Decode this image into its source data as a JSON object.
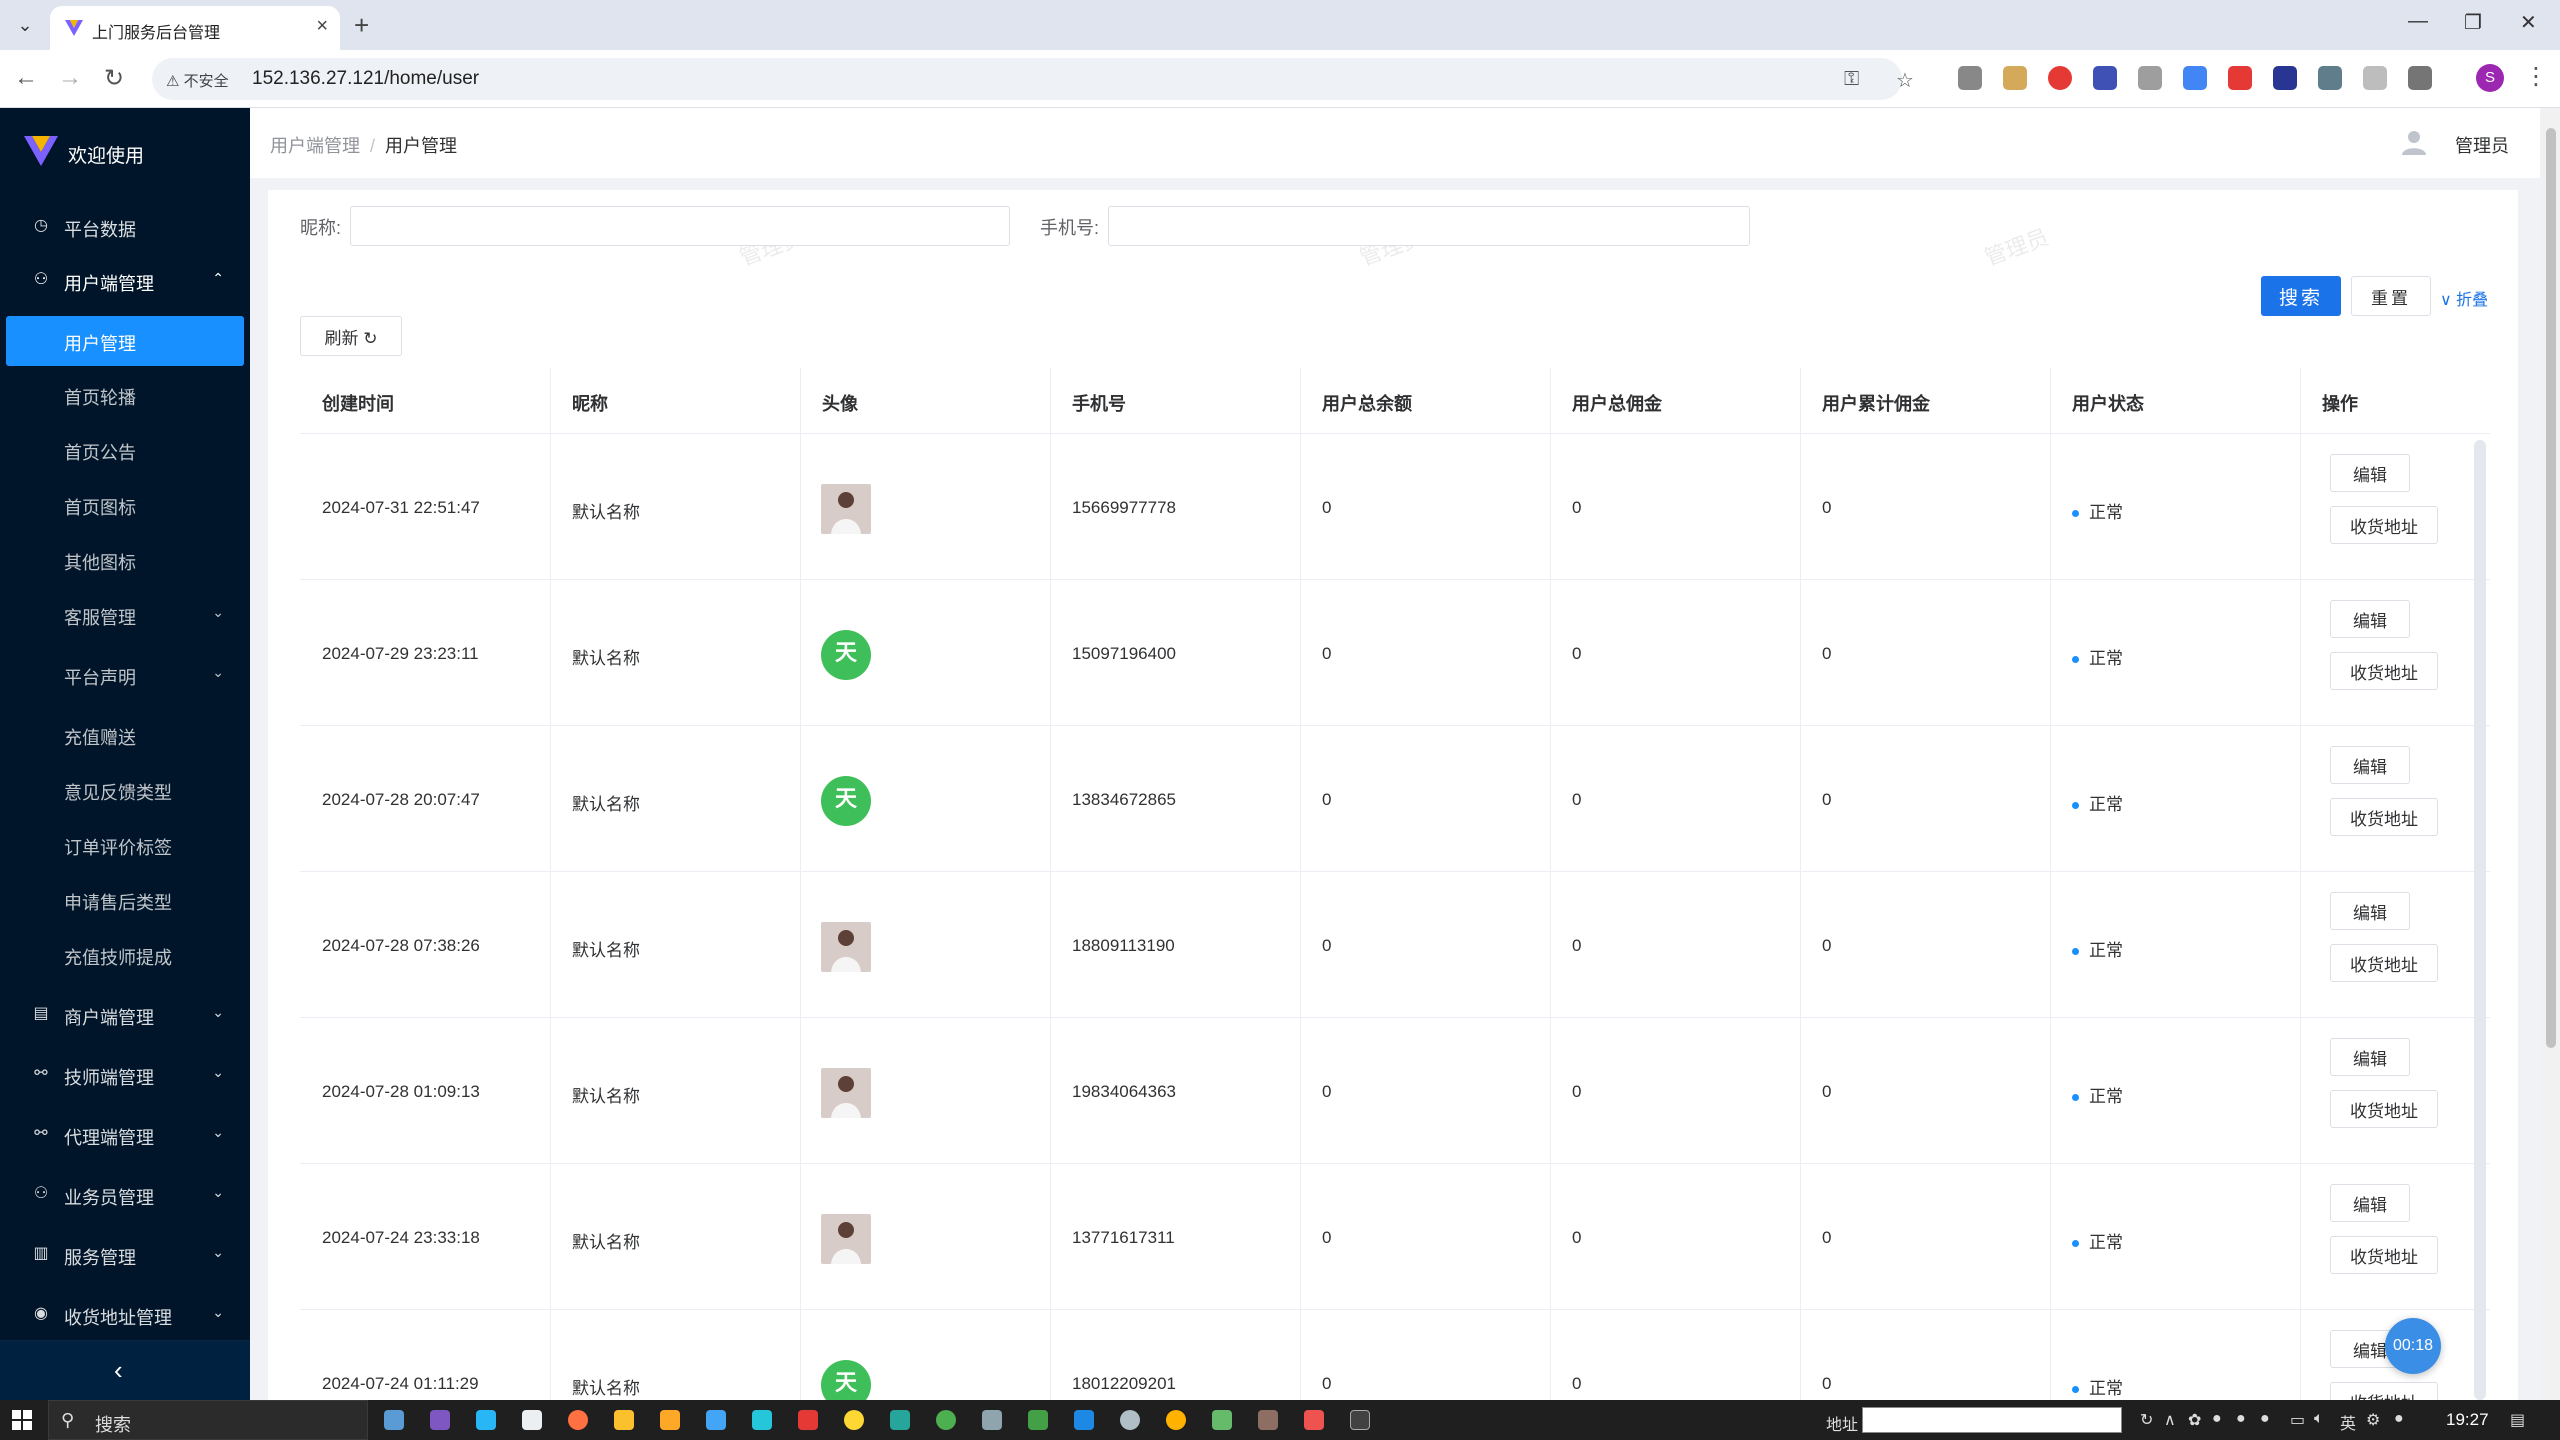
{
  "browser": {
    "tab_title": "上门服务后台管理",
    "insecure_label": "不安全",
    "url": "152.136.27.121/home/user"
  },
  "sidebar": {
    "brand": "欢迎使用",
    "items": [
      {
        "label": "平台数据",
        "icon": "dashboard-icon",
        "type": "top"
      },
      {
        "label": "用户端管理",
        "icon": "user-icon",
        "type": "open"
      },
      {
        "label": "用户管理",
        "type": "active"
      },
      {
        "label": "首页轮播",
        "type": "sub"
      },
      {
        "label": "首页公告",
        "type": "sub"
      },
      {
        "label": "首页图标",
        "type": "sub"
      },
      {
        "label": "其他图标",
        "type": "sub"
      },
      {
        "label": "客服管理",
        "type": "sub-group"
      },
      {
        "label": "平台声明",
        "type": "sub-group"
      },
      {
        "label": "充值赠送",
        "type": "sub"
      },
      {
        "label": "意见反馈类型",
        "type": "sub"
      },
      {
        "label": "订单评价标签",
        "type": "sub"
      },
      {
        "label": "申请售后类型",
        "type": "sub"
      },
      {
        "label": "充值技师提成",
        "type": "sub"
      },
      {
        "label": "商户端管理",
        "icon": "store-icon",
        "type": "top"
      },
      {
        "label": "技师端管理",
        "icon": "technician-icon",
        "type": "top"
      },
      {
        "label": "代理端管理",
        "icon": "agent-icon",
        "type": "top"
      },
      {
        "label": "业务员管理",
        "icon": "user-icon",
        "type": "top"
      },
      {
        "label": "服务管理",
        "icon": "service-icon",
        "type": "top"
      },
      {
        "label": "收货地址管理",
        "icon": "location-icon",
        "type": "top"
      }
    ]
  },
  "header": {
    "breadcrumb_parent": "用户端管理",
    "breadcrumb_sep": "/",
    "breadcrumb_current": "用户管理",
    "user_name": "管理员"
  },
  "filters": {
    "nickname_label": "昵称:",
    "nickname_value": "",
    "phone_label": "手机号:",
    "phone_value": "",
    "search_button": "搜索",
    "reset_button": "重置",
    "collapse_link": "∨ 折叠",
    "refresh_button": "刷新"
  },
  "watermark_text": "管理员",
  "table": {
    "columns": [
      "创建时间",
      "昵称",
      "头像",
      "手机号",
      "用户总余额",
      "用户总佣金",
      "用户累计佣金",
      "用户状态",
      "操作"
    ],
    "edit_label": "编辑",
    "address_label": "收货地址",
    "rows": [
      {
        "created": "2024-07-31 22:51:47",
        "nickname": "默认名称",
        "avatar": "photo",
        "phone": "15669977778",
        "balance": "0",
        "commission": "0",
        "total_commission": "0",
        "status": "正常"
      },
      {
        "created": "2024-07-29 23:23:11",
        "nickname": "默认名称",
        "avatar": "logo",
        "phone": "15097196400",
        "balance": "0",
        "commission": "0",
        "total_commission": "0",
        "status": "正常"
      },
      {
        "created": "2024-07-28 20:07:47",
        "nickname": "默认名称",
        "avatar": "logo",
        "phone": "13834672865",
        "balance": "0",
        "commission": "0",
        "total_commission": "0",
        "status": "正常"
      },
      {
        "created": "2024-07-28 07:38:26",
        "nickname": "默认名称",
        "avatar": "photo",
        "phone": "18809113190",
        "balance": "0",
        "commission": "0",
        "total_commission": "0",
        "status": "正常"
      },
      {
        "created": "2024-07-28 01:09:13",
        "nickname": "默认名称",
        "avatar": "photo",
        "phone": "19834064363",
        "balance": "0",
        "commission": "0",
        "total_commission": "0",
        "status": "正常"
      },
      {
        "created": "2024-07-24 23:33:18",
        "nickname": "默认名称",
        "avatar": "photo",
        "phone": "13771617311",
        "balance": "0",
        "commission": "0",
        "total_commission": "0",
        "status": "正常"
      },
      {
        "created": "2024-07-24 01:11:29",
        "nickname": "默认名称",
        "avatar": "logo",
        "phone": "18012209201",
        "balance": "0",
        "commission": "0",
        "total_commission": "0",
        "status": "正常"
      }
    ]
  },
  "timer": "00:18",
  "taskbar": {
    "search_text": "搜索",
    "addr_label": "地址",
    "lang": "英",
    "clock": "19:27"
  },
  "colors": {
    "sidebar_bg": "#001529",
    "accent": "#1890ff",
    "primary_button": "#1a73e8"
  }
}
